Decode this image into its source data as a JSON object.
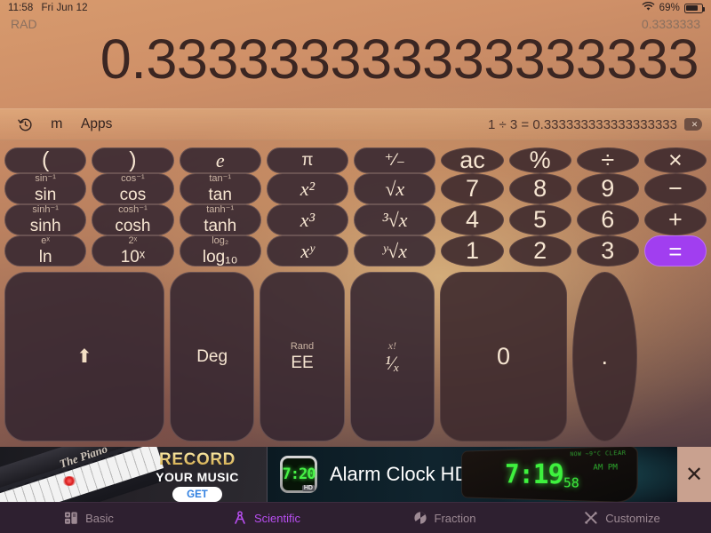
{
  "status_bar": {
    "time": "11:58",
    "date": "Fri Jun 12",
    "wifi_icon": "wifi-icon",
    "battery_percent": "69%",
    "battery_icon": "battery-icon"
  },
  "display": {
    "angle_mode": "RAD",
    "memory_value": "0.3333333",
    "result": "0.333333333333333333"
  },
  "toolbar": {
    "history_icon": "history-clock-icon",
    "memory_label": "m",
    "apps_label": "Apps",
    "expression": "1 ÷ 3 = 0.333333333333333333",
    "delete_icon": "backspace-icon"
  },
  "keypad": {
    "rows": [
      [
        {
          "name": "open-paren",
          "shape": "rect",
          "sub": "",
          "main": "(",
          "style": "sym",
          "flex": "k-w1"
        },
        {
          "name": "close-paren",
          "shape": "rect",
          "sub": "",
          "main": ")",
          "style": "sym",
          "flex": "k-w1"
        },
        {
          "name": "euler-e",
          "shape": "rect",
          "sub": "",
          "main": "e",
          "style": "ital",
          "flex": "k-w1"
        },
        {
          "name": "pi",
          "shape": "rect",
          "sub": "",
          "main": "π",
          "style": "main",
          "flex": "k-w1"
        },
        {
          "name": "plus-minus",
          "shape": "rect",
          "sub": "",
          "main": "⁺⁄₋",
          "style": "main",
          "flex": "k-w1"
        },
        {
          "name": "all-clear",
          "shape": "round",
          "sub": "",
          "main": "ac",
          "style": "big",
          "flex": "k-w-small"
        },
        {
          "name": "percent",
          "shape": "round",
          "sub": "",
          "main": "%",
          "style": "big",
          "flex": "k-w-small"
        },
        {
          "name": "divide",
          "shape": "round",
          "sub": "",
          "main": "÷",
          "style": "big",
          "flex": "k-w-small"
        },
        {
          "name": "multiply",
          "shape": "round",
          "sub": "",
          "main": "×",
          "style": "big",
          "flex": "k-w-small"
        }
      ],
      [
        {
          "name": "sin",
          "shape": "rect",
          "sub": "sin⁻¹",
          "main": "sin",
          "style": "main",
          "flex": "k-w1"
        },
        {
          "name": "cos",
          "shape": "rect",
          "sub": "cos⁻¹",
          "main": "cos",
          "style": "main",
          "flex": "k-w1"
        },
        {
          "name": "tan",
          "shape": "rect",
          "sub": "tan⁻¹",
          "main": "tan",
          "style": "main",
          "flex": "k-w1"
        },
        {
          "name": "x-squared",
          "shape": "rect",
          "sub": "",
          "main": "x²",
          "style": "ital",
          "flex": "k-w1"
        },
        {
          "name": "square-root",
          "shape": "rect",
          "sub": "",
          "main": "√x",
          "style": "ital",
          "flex": "k-w1"
        },
        {
          "name": "digit-7",
          "shape": "round",
          "sub": "",
          "main": "7",
          "style": "big",
          "flex": "k-w-small"
        },
        {
          "name": "digit-8",
          "shape": "round",
          "sub": "",
          "main": "8",
          "style": "big",
          "flex": "k-w-small"
        },
        {
          "name": "digit-9",
          "shape": "round",
          "sub": "",
          "main": "9",
          "style": "big",
          "flex": "k-w-small"
        },
        {
          "name": "minus",
          "shape": "round",
          "sub": "",
          "main": "−",
          "style": "big",
          "flex": "k-w-small"
        }
      ],
      [
        {
          "name": "sinh",
          "shape": "rect",
          "sub": "sinh⁻¹",
          "main": "sinh",
          "style": "main",
          "flex": "k-w1"
        },
        {
          "name": "cosh",
          "shape": "rect",
          "sub": "cosh⁻¹",
          "main": "cosh",
          "style": "main",
          "flex": "k-w1"
        },
        {
          "name": "tanh",
          "shape": "rect",
          "sub": "tanh⁻¹",
          "main": "tanh",
          "style": "main",
          "flex": "k-w1"
        },
        {
          "name": "x-cubed",
          "shape": "rect",
          "sub": "",
          "main": "x³",
          "style": "ital",
          "flex": "k-w1"
        },
        {
          "name": "cube-root",
          "shape": "rect",
          "sub": "",
          "main": "³√x",
          "style": "ital",
          "flex": "k-w1"
        },
        {
          "name": "digit-4",
          "shape": "round",
          "sub": "",
          "main": "4",
          "style": "big",
          "flex": "k-w-small"
        },
        {
          "name": "digit-5",
          "shape": "round",
          "sub": "",
          "main": "5",
          "style": "big",
          "flex": "k-w-small"
        },
        {
          "name": "digit-6",
          "shape": "round",
          "sub": "",
          "main": "6",
          "style": "big",
          "flex": "k-w-small"
        },
        {
          "name": "plus",
          "shape": "round",
          "sub": "",
          "main": "+",
          "style": "big",
          "flex": "k-w-small"
        }
      ],
      [
        {
          "name": "natural-log",
          "shape": "rect",
          "sub": "eˣ",
          "main": "ln",
          "style": "main",
          "flex": "k-w1"
        },
        {
          "name": "ten-power-x",
          "shape": "rect",
          "sub": "2ˣ",
          "main": "10ˣ",
          "style": "main",
          "flex": "k-w1"
        },
        {
          "name": "log-base-10",
          "shape": "rect",
          "sub": "log₂",
          "main": "log₁₀",
          "style": "main",
          "flex": "k-w1"
        },
        {
          "name": "x-power-y",
          "shape": "rect",
          "sub": "",
          "main": "xʸ",
          "style": "ital",
          "flex": "k-w1"
        },
        {
          "name": "y-root-x",
          "shape": "rect",
          "sub": "",
          "main": "ʸ√x",
          "style": "ital",
          "flex": "k-w1"
        },
        {
          "name": "digit-1",
          "shape": "round",
          "sub": "",
          "main": "1",
          "style": "big",
          "flex": "k-w-small"
        },
        {
          "name": "digit-2",
          "shape": "round",
          "sub": "",
          "main": "2",
          "style": "big",
          "flex": "k-w-small"
        },
        {
          "name": "digit-3",
          "shape": "round",
          "sub": "",
          "main": "3",
          "style": "big",
          "flex": "k-w-small"
        },
        {
          "name": "equals",
          "shape": "equals",
          "sub": "",
          "main": "=",
          "style": "big",
          "flex": "k-w-small"
        }
      ]
    ],
    "bottom_row": {
      "shift_icon": "shift-up-arrow-icon",
      "deg_label": "Deg",
      "ee_sub": "Rand",
      "ee_main": "EE",
      "recip_sub": "x!",
      "recip_main": "¹⁄ₓ",
      "zero_label": "0",
      "decimal_label": "."
    }
  },
  "ad": {
    "left": {
      "brand": "The Piano",
      "headline": "RECORD",
      "subhead": "YOUR MUSIC",
      "cta": "GET"
    },
    "right": {
      "app_icon_time": "7:20",
      "app_icon_badge": "HD",
      "title": "Alarm Clock HD",
      "clock_hours": "7:19",
      "clock_seconds": "58",
      "clock_ampm": "AM  PM",
      "clock_top_label": "NOW ~9°C CLEAR"
    },
    "close_icon": "close-x-icon"
  },
  "tabbar": {
    "tabs": [
      {
        "label": "Basic",
        "icon": "basic-calculator-icon",
        "active": false
      },
      {
        "label": "Scientific",
        "icon": "compass-divider-icon",
        "active": true
      },
      {
        "label": "Fraction",
        "icon": "pie-fraction-icon",
        "active": false
      },
      {
        "label": "Customize",
        "icon": "tools-wrench-icon",
        "active": false
      }
    ],
    "active_color": "#b84ef0",
    "inactive_color": "#9d8a94"
  }
}
